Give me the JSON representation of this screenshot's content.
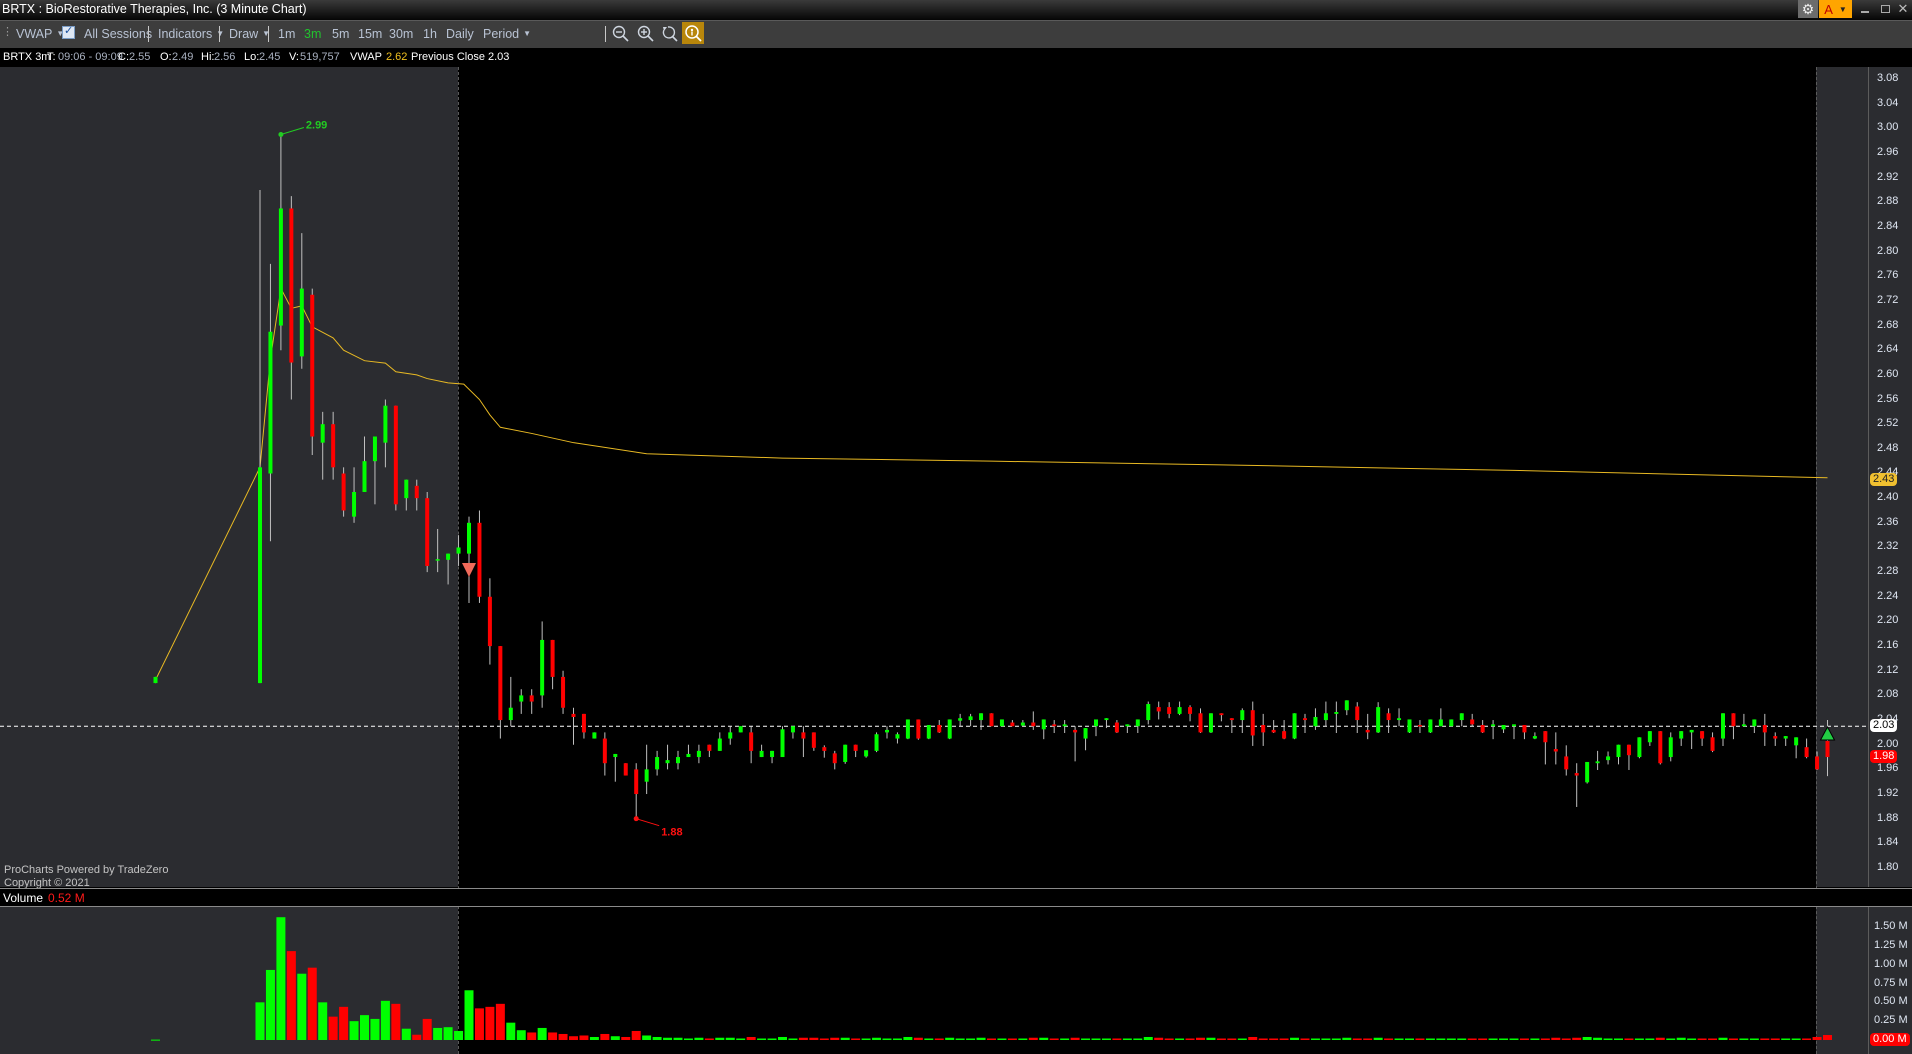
{
  "window": {
    "title": "BRTX : BioRestorative Therapies, Inc. (3 Minute Chart)",
    "gear_icon": "gear-icon",
    "theme_button": "A"
  },
  "toolbar": {
    "vwap": "VWAP",
    "all_sessions": "All Sessions",
    "all_sessions_checked": true,
    "indicators": "Indicators",
    "draw": "Draw",
    "intervals": [
      "1m",
      "3m",
      "5m",
      "15m",
      "30m",
      "1h",
      "Daily"
    ],
    "active_interval": "3m",
    "period": "Period"
  },
  "info": {
    "symbol": "BRTX 3m",
    "t_label": "T:",
    "t_value": "09:06 - 09:09",
    "c_label": "C:",
    "c_value": "2.55",
    "o_label": "O:",
    "o_value": "2.49",
    "hi_label": "Hi:",
    "hi_value": "2.56",
    "lo_label": "Lo:",
    "lo_value": "2.45",
    "v_label": "V:",
    "v_value": "519,757",
    "vwap_label": "VWAP",
    "vwap_value": "2.62",
    "prev_close_label": "Previous Close",
    "prev_close_value": "2.03"
  },
  "credit": {
    "line1": "ProCharts Powered by TradeZero",
    "line2": "Copyright © 2021"
  },
  "volume_header": {
    "label": "Volume",
    "value": "0.52 M"
  },
  "colors": {
    "up": "#00ff00",
    "down": "#ff0000",
    "vwap": "#e8b923",
    "accent": "#ffa500"
  },
  "chart_data": {
    "type": "candlestick",
    "symbol": "BRTX",
    "interval": "3m",
    "fields": [
      "open",
      "close",
      "high",
      "low"
    ],
    "ylim": [
      1.78,
      3.1
    ],
    "price_ticks": [
      "3.08",
      "3.04",
      "3.00",
      "2.96",
      "2.92",
      "2.88",
      "2.84",
      "2.80",
      "2.76",
      "2.72",
      "2.68",
      "2.64",
      "2.60",
      "2.56",
      "2.52",
      "2.48",
      "2.44",
      "2.40",
      "2.36",
      "2.32",
      "2.28",
      "2.24",
      "2.20",
      "2.16",
      "2.12",
      "2.08",
      "2.04",
      "2.00",
      "1.96",
      "1.92",
      "1.88",
      "1.84",
      "1.80"
    ],
    "volume_ticks": [
      "1.50 M",
      "1.25 M",
      "1.00 M",
      "0.75 M",
      "0.50 M",
      "0.25 M",
      "0.00 M"
    ],
    "volume_max_m": 1.5,
    "session_open_index": 29.5,
    "badges": {
      "vwap": "2.43",
      "prev_close": "2.03",
      "last": "1.98",
      "volume": "0.00 M"
    },
    "prev_close": 2.03,
    "high_marker": {
      "index": 12,
      "price": 2.99,
      "label": "2.99"
    },
    "low_marker": {
      "index": 46,
      "price": 1.88,
      "label": "1.88"
    },
    "sell_signal_index": 30,
    "buy_signal_index": 160,
    "candles": [
      [
        2.1,
        2.11,
        2.11,
        2.1
      ],
      null,
      null,
      null,
      null,
      null,
      null,
      null,
      null,
      null,
      [
        2.1,
        2.45,
        2.9,
        2.1
      ],
      [
        2.44,
        2.67,
        2.78,
        2.33
      ],
      [
        2.68,
        2.87,
        2.99,
        2.64
      ],
      [
        2.87,
        2.62,
        2.89,
        2.56
      ],
      [
        2.63,
        2.74,
        2.83,
        2.61
      ],
      [
        2.73,
        2.5,
        2.74,
        2.47
      ],
      [
        2.49,
        2.52,
        2.54,
        2.43
      ],
      [
        2.52,
        2.45,
        2.54,
        2.43
      ],
      [
        2.44,
        2.38,
        2.45,
        2.37
      ],
      [
        2.37,
        2.41,
        2.45,
        2.36
      ],
      [
        2.41,
        2.46,
        2.5,
        2.41
      ],
      [
        2.46,
        2.5,
        2.5,
        2.39
      ],
      [
        2.49,
        2.55,
        2.56,
        2.45
      ],
      [
        2.55,
        2.39,
        2.55,
        2.38
      ],
      [
        2.4,
        2.43,
        2.43,
        2.38
      ],
      [
        2.42,
        2.4,
        2.43,
        2.38
      ],
      [
        2.4,
        2.29,
        2.41,
        2.28
      ],
      [
        2.3,
        2.301,
        2.35,
        2.28
      ],
      [
        2.3,
        2.31,
        2.31,
        2.26
      ],
      [
        2.31,
        2.32,
        2.34,
        2.29
      ],
      [
        2.31,
        2.36,
        2.37,
        2.23
      ],
      [
        2.36,
        2.24,
        2.38,
        2.23
      ],
      [
        2.24,
        2.16,
        2.27,
        2.13
      ],
      [
        2.16,
        2.04,
        2.16,
        2.01
      ],
      [
        2.04,
        2.06,
        2.11,
        2.03
      ],
      [
        2.07,
        2.08,
        2.09,
        2.05
      ],
      [
        2.08,
        2.07,
        2.09,
        2.05
      ],
      [
        2.08,
        2.17,
        2.2,
        2.06
      ],
      [
        2.17,
        2.11,
        2.17,
        2.09
      ],
      [
        2.11,
        2.06,
        2.12,
        2.05
      ],
      [
        2.05,
        2.045,
        2.06,
        2.0
      ],
      [
        2.05,
        2.02,
        2.05,
        2.01
      ],
      [
        2.01,
        2.02,
        2.02,
        2.01
      ],
      [
        2.01,
        1.97,
        2.02,
        1.95
      ],
      [
        1.98,
        1.985,
        1.985,
        1.94
      ],
      [
        1.97,
        1.95,
        1.97,
        1.95
      ],
      [
        1.96,
        1.92,
        1.97,
        1.88
      ],
      [
        1.94,
        1.96,
        2.0,
        1.92
      ],
      [
        1.96,
        1.98,
        1.99,
        1.95
      ],
      [
        1.97,
        1.975,
        2.0,
        1.96
      ],
      [
        1.97,
        1.98,
        1.99,
        1.96
      ],
      [
        1.98,
        1.985,
        2.0,
        1.98
      ],
      [
        1.98,
        1.99,
        2.0,
        1.97
      ],
      [
        2.0,
        1.99,
        2.0,
        1.98
      ],
      [
        1.99,
        2.01,
        2.02,
        1.99
      ],
      [
        2.01,
        2.02,
        2.03,
        2.0
      ],
      [
        2.02,
        2.03,
        2.03,
        2.02
      ],
      [
        2.02,
        1.99,
        2.03,
        1.97
      ],
      [
        1.98,
        1.99,
        2.0,
        1.98
      ],
      [
        1.98,
        1.99,
        1.99,
        1.97
      ],
      [
        1.98,
        2.025,
        2.03,
        1.98
      ],
      [
        2.02,
        2.03,
        2.03,
        2.01
      ],
      [
        2.02,
        2.01,
        2.03,
        1.98
      ],
      [
        2.02,
        1.995,
        2.02,
        1.99
      ],
      [
        1.996,
        1.99,
        1.999,
        1.979
      ],
      [
        1.986,
        1.97,
        1.99,
        1.96
      ],
      [
        1.972,
        2.0,
        2.0,
        1.969
      ],
      [
        2.0,
        1.99,
        2.0,
        1.98
      ],
      [
        1.981,
        1.991,
        1.991,
        1.979
      ],
      [
        1.99,
        2.017,
        2.02,
        1.988
      ],
      [
        2.02,
        2.024,
        2.03,
        2.01
      ],
      [
        2.01,
        2.017,
        2.02,
        2.002
      ],
      [
        2.01,
        2.041,
        2.041,
        2.009
      ],
      [
        2.041,
        2.01,
        2.041,
        2.008
      ],
      [
        2.01,
        2.032,
        2.032,
        2.009
      ],
      [
        2.032,
        2.02,
        2.04,
        2.019
      ],
      [
        2.01,
        2.041,
        2.041,
        2.009
      ],
      [
        2.039,
        2.043,
        2.05,
        2.03
      ],
      [
        2.04,
        2.046,
        2.05,
        2.03
      ],
      [
        2.04,
        2.051,
        2.051,
        2.024
      ],
      [
        2.051,
        2.03,
        2.051,
        2.03
      ],
      [
        2.03,
        2.041,
        2.041,
        2.03
      ],
      [
        2.036,
        2.03,
        2.04,
        2.03
      ],
      [
        2.031,
        2.036,
        2.04,
        2.03
      ],
      [
        2.036,
        2.03,
        2.054,
        2.024
      ],
      [
        2.025,
        2.041,
        2.041,
        2.009
      ],
      [
        2.033,
        2.03,
        2.04,
        2.019
      ],
      [
        2.03,
        2.033,
        2.04,
        2.019
      ],
      [
        2.024,
        2.02,
        2.03,
        1.973
      ],
      [
        2.01,
        2.027,
        2.027,
        1.991
      ],
      [
        2.03,
        2.041,
        2.041,
        2.014
      ],
      [
        2.04,
        2.043,
        2.043,
        2.027
      ],
      [
        2.036,
        2.02,
        2.04,
        2.019
      ],
      [
        2.03,
        2.033,
        2.033,
        2.019
      ],
      [
        2.03,
        2.041,
        2.041,
        2.019
      ],
      [
        2.04,
        2.066,
        2.07,
        2.033
      ],
      [
        2.061,
        2.054,
        2.07,
        2.041
      ],
      [
        2.061,
        2.05,
        2.069,
        2.043
      ],
      [
        2.05,
        2.061,
        2.07,
        2.048
      ],
      [
        2.061,
        2.05,
        2.064,
        2.038
      ],
      [
        2.051,
        2.02,
        2.059,
        2.019
      ],
      [
        2.02,
        2.051,
        2.051,
        2.019
      ],
      [
        2.051,
        2.048,
        2.051,
        2.038
      ],
      [
        2.043,
        2.04,
        2.043,
        2.019
      ],
      [
        2.04,
        2.056,
        2.059,
        2.019
      ],
      [
        2.056,
        2.015,
        2.07,
        1.998
      ],
      [
        2.032,
        2.02,
        2.05,
        1.998
      ],
      [
        2.024,
        2.02,
        2.04,
        2.019
      ],
      [
        2.022,
        2.01,
        2.04,
        2.009
      ],
      [
        2.01,
        2.051,
        2.051,
        2.009
      ],
      [
        2.043,
        2.04,
        2.05,
        2.019
      ],
      [
        2.03,
        2.045,
        2.059,
        2.024
      ],
      [
        2.04,
        2.051,
        2.07,
        2.03
      ],
      [
        2.05,
        2.053,
        2.07,
        2.019
      ],
      [
        2.056,
        2.072,
        2.072,
        2.048
      ],
      [
        2.062,
        2.04,
        2.069,
        2.019
      ],
      [
        2.024,
        2.02,
        2.05,
        2.009
      ],
      [
        2.02,
        2.061,
        2.069,
        2.019
      ],
      [
        2.051,
        2.04,
        2.059,
        2.019
      ],
      [
        2.04,
        2.043,
        2.059,
        2.03
      ],
      [
        2.02,
        2.041,
        2.041,
        2.019
      ],
      [
        2.032,
        2.03,
        2.04,
        2.019
      ],
      [
        2.02,
        2.041,
        2.041,
        2.019
      ],
      [
        2.03,
        2.041,
        2.059,
        2.03
      ],
      [
        2.03,
        2.041,
        2.041,
        2.03
      ],
      [
        2.04,
        2.051,
        2.051,
        2.03
      ],
      [
        2.041,
        2.033,
        2.05,
        2.03
      ],
      [
        2.032,
        2.02,
        2.04,
        2.019
      ],
      [
        2.03,
        2.033,
        2.04,
        2.009
      ],
      [
        2.025,
        2.032,
        2.032,
        2.019
      ],
      [
        2.03,
        2.033,
        2.033,
        2.009
      ],
      [
        2.032,
        2.02,
        2.032,
        2.009
      ],
      [
        2.01,
        2.014,
        2.02,
        2.009
      ],
      [
        2.022,
        2.004,
        2.022,
        1.968
      ],
      [
        1.993,
        1.989,
        2.02,
        1.968
      ],
      [
        1.981,
        1.96,
        1.999,
        1.95
      ],
      [
        1.954,
        1.95,
        1.97,
        1.899
      ],
      [
        1.939,
        1.972,
        1.972,
        1.937
      ],
      [
        1.97,
        1.973,
        1.99,
        1.959
      ],
      [
        1.975,
        1.981,
        1.989,
        1.968
      ],
      [
        1.98,
        2.0,
        2.0,
        1.968
      ],
      [
        2.0,
        1.983,
        2.0,
        1.959
      ],
      [
        1.98,
        2.012,
        2.012,
        1.978
      ],
      [
        2.004,
        2.022,
        2.022,
        1.998
      ],
      [
        2.022,
        1.97,
        2.022,
        1.968
      ],
      [
        1.98,
        2.012,
        2.02,
        1.973
      ],
      [
        2.01,
        2.022,
        2.022,
        1.998
      ],
      [
        2.02,
        2.024,
        2.024,
        1.993
      ],
      [
        2.022,
        2.01,
        2.022,
        1.998
      ],
      [
        2.012,
        1.99,
        2.02,
        1.988
      ],
      [
        2.01,
        2.051,
        2.051,
        1.998
      ],
      [
        2.051,
        2.03,
        2.051,
        2.009
      ],
      [
        2.03,
        2.033,
        2.05,
        2.03
      ],
      [
        2.03,
        2.041,
        2.041,
        2.019
      ],
      [
        2.032,
        2.02,
        2.05,
        1.998
      ],
      [
        2.014,
        2.01,
        2.02,
        1.998
      ],
      [
        2.01,
        2.014,
        2.014,
        1.998
      ],
      [
        1.999,
        2.012,
        2.012,
        1.978
      ],
      [
        1.996,
        1.98,
        2.01,
        1.978
      ],
      [
        1.981,
        1.96,
        1.989,
        1.959
      ],
      [
        2.006,
        1.98,
        2.04,
        1.949
      ]
    ],
    "volume_m": [
      0.005,
      null,
      null,
      null,
      null,
      null,
      null,
      null,
      null,
      null,
      0.5,
      0.93,
      1.63,
      1.18,
      0.88,
      0.96,
      0.5,
      0.31,
      0.44,
      0.25,
      0.33,
      0.28,
      0.52,
      0.48,
      0.15,
      0.07,
      0.28,
      0.16,
      0.17,
      0.12,
      0.66,
      0.42,
      0.44,
      0.48,
      0.23,
      0.13,
      0.1,
      0.16,
      0.1,
      0.08,
      0.05,
      0.06,
      0.04,
      0.08,
      0.05,
      0.04,
      0.12,
      0.06,
      0.04,
      0.03,
      0.03,
      0.02,
      0.03,
      0.02,
      0.03,
      0.03,
      0.02,
      0.04,
      0.02,
      0.02,
      0.04,
      0.02,
      0.03,
      0.03,
      0.02,
      0.03,
      0.03,
      0.02,
      0.02,
      0.03,
      0.02,
      0.02,
      0.04,
      0.03,
      0.02,
      0.02,
      0.03,
      0.02,
      0.02,
      0.03,
      0.02,
      0.02,
      0.02,
      0.02,
      0.03,
      0.03,
      0.02,
      0.02,
      0.03,
      0.02,
      0.02,
      0.02,
      0.02,
      0.02,
      0.02,
      0.04,
      0.03,
      0.02,
      0.02,
      0.02,
      0.03,
      0.03,
      0.02,
      0.02,
      0.02,
      0.04,
      0.02,
      0.02,
      0.02,
      0.03,
      0.02,
      0.02,
      0.02,
      0.02,
      0.03,
      0.02,
      0.02,
      0.03,
      0.02,
      0.02,
      0.02,
      0.02,
      0.02,
      0.02,
      0.02,
      0.02,
      0.02,
      0.02,
      0.02,
      0.02,
      0.02,
      0.02,
      0.02,
      0.02,
      0.03,
      0.02,
      0.03,
      0.04,
      0.03,
      0.02,
      0.02,
      0.02,
      0.02,
      0.02,
      0.03,
      0.02,
      0.03,
      0.02,
      0.02,
      0.02,
      0.03,
      0.02,
      0.02,
      0.02,
      0.02,
      0.02,
      0.02,
      0.02,
      0.02,
      0.04,
      0.066
    ],
    "vwap": [
      [
        0,
        2.105
      ],
      [
        10,
        2.45
      ],
      [
        11,
        2.626
      ],
      [
        12,
        2.74
      ],
      [
        13,
        2.708
      ],
      [
        14,
        2.712
      ],
      [
        15,
        2.678
      ],
      [
        17,
        2.66
      ],
      [
        18,
        2.64
      ],
      [
        20,
        2.623
      ],
      [
        22,
        2.619
      ],
      [
        23,
        2.605
      ],
      [
        25,
        2.6
      ],
      [
        26,
        2.594
      ],
      [
        28,
        2.587
      ],
      [
        29.5,
        2.585
      ],
      [
        31,
        2.56
      ],
      [
        32,
        2.535
      ],
      [
        33,
        2.515
      ],
      [
        36,
        2.505
      ],
      [
        40,
        2.49
      ],
      [
        47,
        2.472
      ],
      [
        60,
        2.465
      ],
      [
        80,
        2.46
      ],
      [
        102,
        2.454
      ],
      [
        130,
        2.445
      ],
      [
        160,
        2.433
      ]
    ]
  }
}
